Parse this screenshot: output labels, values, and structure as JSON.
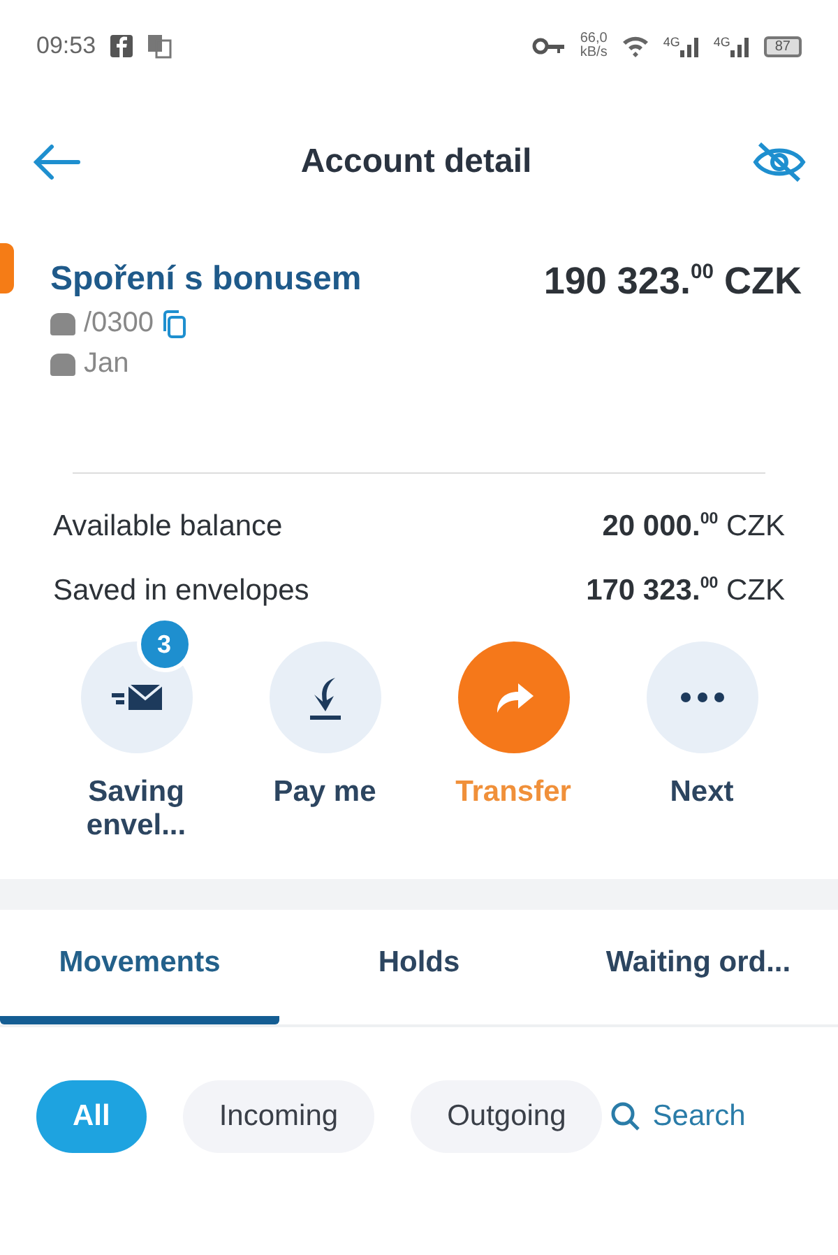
{
  "status_bar": {
    "time": "09:53",
    "net_speed": "66,0",
    "net_unit": "kB/s",
    "signals": [
      "4G",
      "4G"
    ],
    "battery": "87"
  },
  "header": {
    "title": "Account detail"
  },
  "account": {
    "name": "Spoření s bonusem",
    "balance": "190 323.$^{00}$",
    "currency": "CZK",
    "number": "/0300",
    "owner": "Jan"
  },
  "balances": [
    {
      "label": "Available balance",
      "amount": "20 000.$^{00}$",
      "currency": "CZK"
    },
    {
      "label": "Saved in envelopes",
      "amount": "170 323.$^{00}$",
      "currency": "CZK"
    }
  ],
  "actions": [
    {
      "kind": "envelope",
      "label": "Saving envel...",
      "badge": "3",
      "primary": false
    },
    {
      "kind": "payme",
      "label": "Pay me",
      "primary": false
    },
    {
      "kind": "transfer",
      "label": "Transfer",
      "primary": true
    },
    {
      "kind": "more",
      "label": "Next",
      "primary": false
    }
  ],
  "tabs": [
    {
      "label": "Movements",
      "selected": true
    },
    {
      "label": "Holds",
      "selected": false
    },
    {
      "label": "Waiting ord...",
      "selected": false
    }
  ],
  "filters": [
    {
      "label": "All",
      "selected": true
    },
    {
      "label": "Incoming",
      "selected": false
    },
    {
      "label": "Outgoing",
      "selected": false
    }
  ],
  "search": {
    "label": "Search"
  }
}
